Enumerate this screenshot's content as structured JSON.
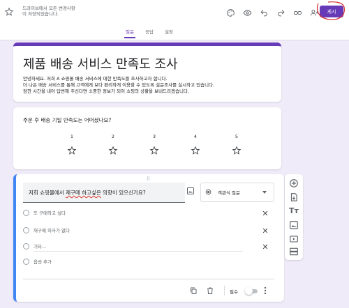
{
  "header": {
    "save_status_line1": "드라이브에서 모든 변경사항",
    "save_status_line2": "이 저장되었습니다.",
    "publish_label": "게시",
    "icons": [
      "palette-icon",
      "preview-eye-icon",
      "undo-icon",
      "redo-icon",
      "link-icon",
      "add-collaborator-icon"
    ]
  },
  "tabs": [
    {
      "label": "질문",
      "active": true
    },
    {
      "label": "응답",
      "active": false
    },
    {
      "label": "설정",
      "active": false
    }
  ],
  "form": {
    "title": "제품 배송 서비스 만족도 조사",
    "description_line1": "안녕하세요. 저희 A 쇼핑몰 배송 서비스에 대한 만족도를 조사하고자 합니다.",
    "description_line2": "더 나은 배송 서비스를 통해 고객에게 보다 편리하게 이용할 수 있도록 설문조사를 실시하고 있습니다.",
    "description_line3": "잠깐 시간을 내어 답변해 주신다면 소중한 정보가 되어 쇼핑의 상황을 보내드리겠습니다."
  },
  "question1": {
    "title": "주문 후 배송 기일 만족도는 어떠셨나요?",
    "scale": [
      "1",
      "2",
      "3",
      "4",
      "5"
    ]
  },
  "question2": {
    "title_pre": "저희 쇼핑몰에서 ",
    "title_squiggle": "재구매 하고싶은",
    "title_post": " 의향이 있으신가요?",
    "type_label": "객관식 질문",
    "options": [
      "또 구매하고 싶다",
      "재구매 의사가 없다",
      "기타..."
    ],
    "add_option_label": "옵션 추가",
    "required_label": "필수"
  },
  "colors": {
    "accent": "#673ab7",
    "active_card_border": "#4285f4",
    "background": "#f0ebf8",
    "annotation_circle": "#d32f2f"
  }
}
